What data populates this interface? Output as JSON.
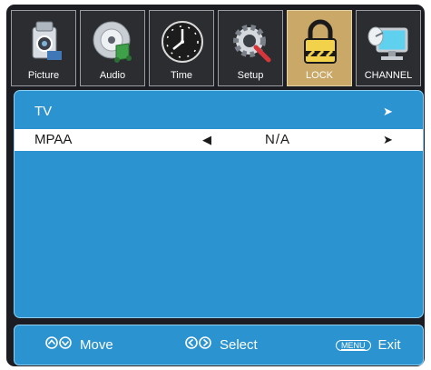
{
  "tabs": [
    {
      "label": "Picture",
      "icon": "camera-icon",
      "active": false
    },
    {
      "label": "Audio",
      "icon": "audio-disc-icon",
      "active": false
    },
    {
      "label": "Time",
      "icon": "clock-icon",
      "active": false
    },
    {
      "label": "Setup",
      "icon": "gear-wrench-icon",
      "active": false
    },
    {
      "label": "LOCK",
      "icon": "padlock-icon",
      "active": true
    },
    {
      "label": "CHANNEL",
      "icon": "satellite-dish-icon",
      "active": false
    }
  ],
  "menu": {
    "tv": {
      "label": "TV",
      "arrow": "➤"
    },
    "mpaa": {
      "label": "MPAA",
      "value": "N/A",
      "left_arrow": "◀",
      "right_arrow": "➤"
    }
  },
  "footer": {
    "move_label": "Move",
    "select_label": "Select",
    "exit_key": "MENU",
    "exit_label": "Exit"
  },
  "colors": {
    "panel": "#2a93d0",
    "frame": "#1b1d22",
    "active_tab": "#c9a868",
    "highlight_row": "#ffffff"
  }
}
